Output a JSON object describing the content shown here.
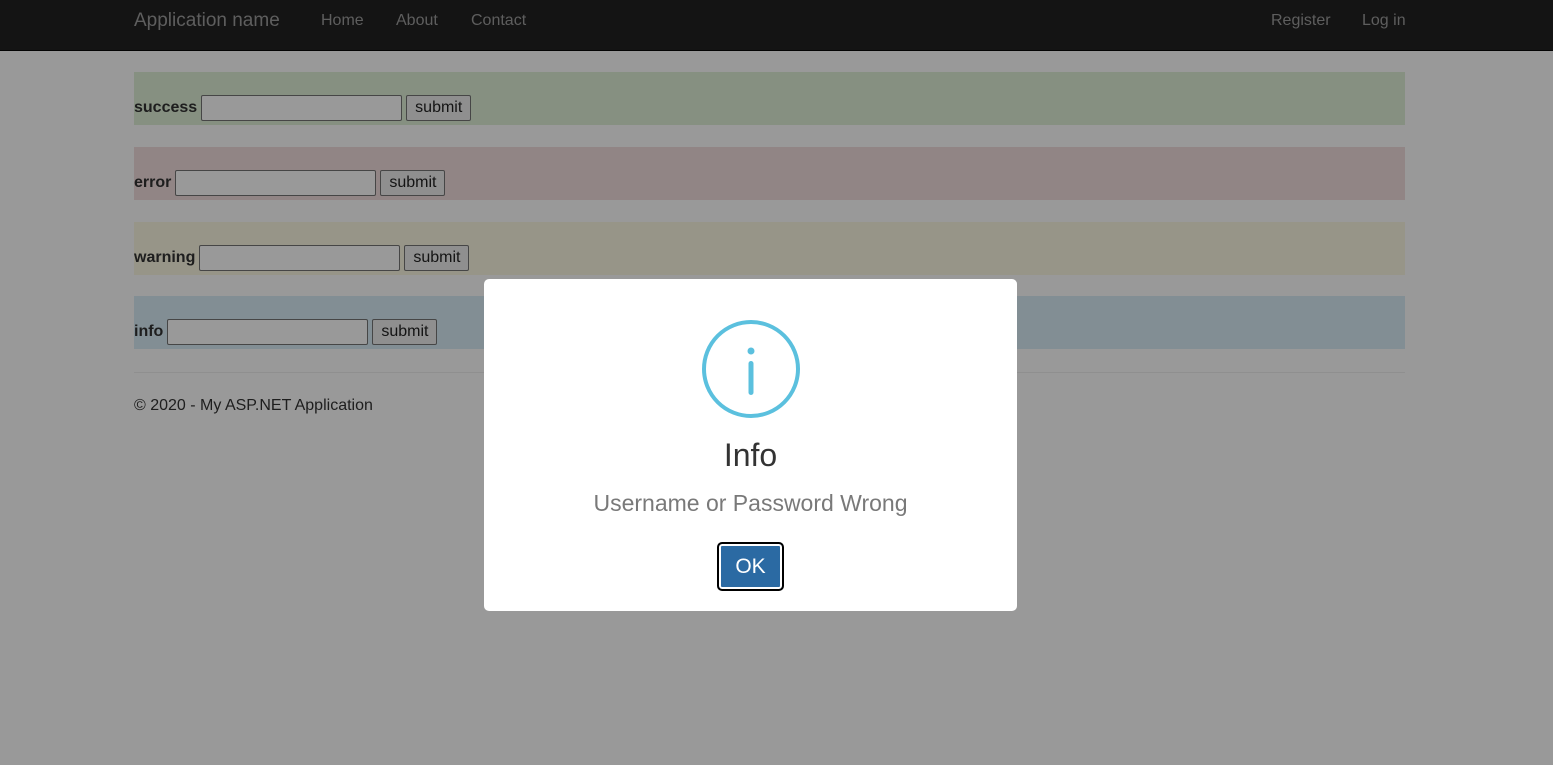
{
  "navbar": {
    "brand": "Application name",
    "links": [
      "Home",
      "About",
      "Contact"
    ],
    "right_links": [
      "Register",
      "Log in"
    ]
  },
  "forms": [
    {
      "label": "success",
      "button": "submit",
      "color": "#dff0d8"
    },
    {
      "label": "error",
      "button": "submit",
      "color": "#f2dede"
    },
    {
      "label": "warning",
      "button": "submit",
      "color": "#fcf8e3"
    },
    {
      "label": "info",
      "button": "submit",
      "color": "#d9edf7"
    }
  ],
  "footer": {
    "text": "© 2020 - My ASP.NET Application"
  },
  "modal": {
    "icon": "info-icon",
    "icon_color": "#5bc0de",
    "title": "Info",
    "message": "Username or Password Wrong",
    "ok_label": "OK",
    "ok_color": "#2b6aa3"
  }
}
